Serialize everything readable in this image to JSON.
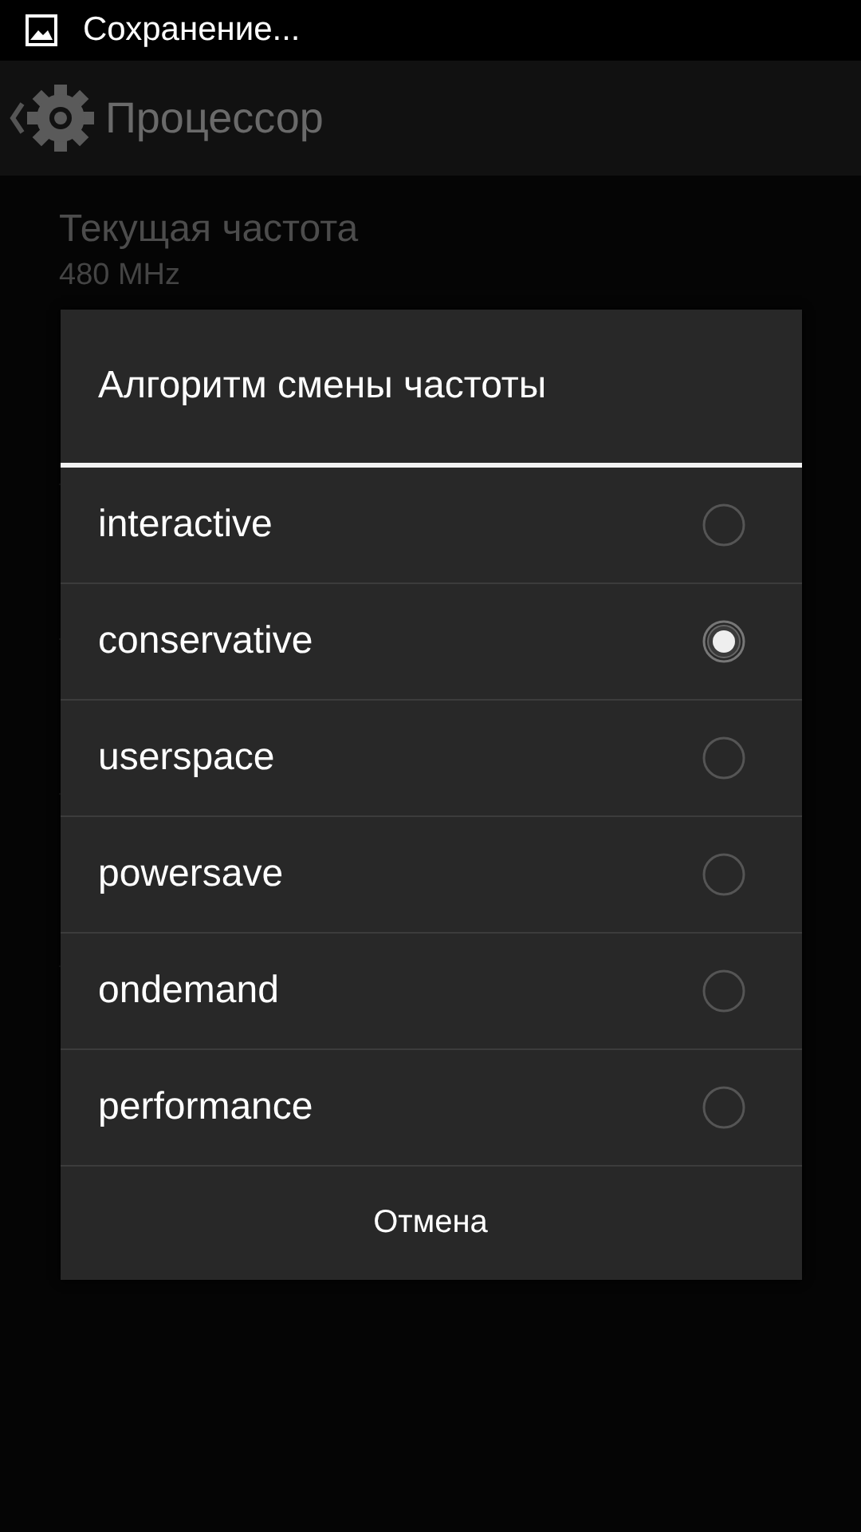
{
  "status_bar": {
    "notification": "Сохранение..."
  },
  "action_bar": {
    "title": "Процессор"
  },
  "settings": [
    {
      "title": "Текущая частота",
      "summary": "480 MHz"
    }
  ],
  "dialog": {
    "title": "Алгоритм смены частоты",
    "options": [
      {
        "label": "interactive",
        "selected": false
      },
      {
        "label": "conservative",
        "selected": true
      },
      {
        "label": "userspace",
        "selected": false
      },
      {
        "label": "powersave",
        "selected": false
      },
      {
        "label": "ondemand",
        "selected": false
      },
      {
        "label": "performance",
        "selected": false
      }
    ],
    "cancel": "Отмена"
  }
}
